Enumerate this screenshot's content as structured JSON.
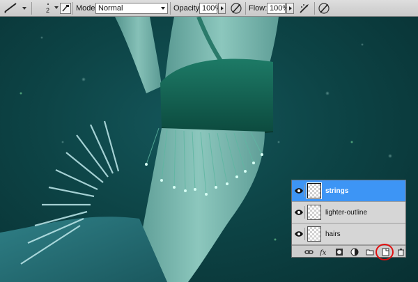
{
  "options_bar": {
    "tool_icon": "brush-icon",
    "brush_size": "2",
    "mode_label": "Mode:",
    "mode_value": "Normal",
    "opacity_label": "Opacity:",
    "opacity_value": "100%",
    "flow_label": "Flow:",
    "flow_value": "100%"
  },
  "layers_panel": {
    "layers": [
      {
        "name": "strings",
        "selected": true
      },
      {
        "name": "lighter-outline",
        "selected": false
      },
      {
        "name": "hairs",
        "selected": false
      }
    ],
    "footer_icons": [
      "link-icon",
      "fx-icon",
      "layer-mask-icon",
      "adjustment-layer-icon",
      "folder-icon",
      "new-layer-icon",
      "trash-icon"
    ],
    "highlight_color": "#e01010",
    "selected_color": "#3d95f5"
  }
}
